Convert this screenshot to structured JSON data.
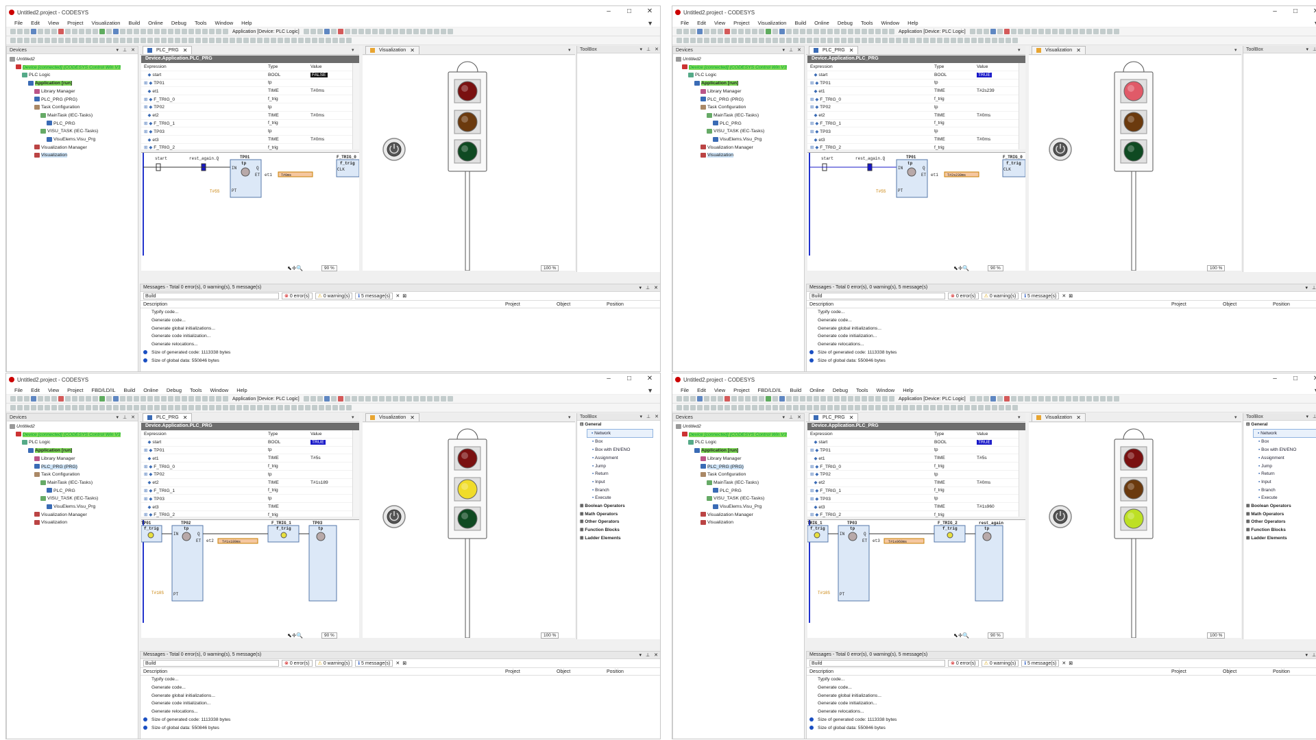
{
  "title": "Untitled2.project - CODESYS",
  "window_controls": [
    "–",
    "□",
    "✕"
  ],
  "menus_a": [
    "File",
    "Edit",
    "View",
    "Project",
    "Visualization",
    "Build",
    "Online",
    "Debug",
    "Tools",
    "Window",
    "Help"
  ],
  "menus_b": [
    "File",
    "Edit",
    "View",
    "Project",
    "FBD/LD/IL",
    "Build",
    "Online",
    "Debug",
    "Tools",
    "Window",
    "Help"
  ],
  "toolbar_app": "Application [Device: PLC Logic]",
  "devices_panel": "Devices",
  "toolbox_panel": "ToolBox",
  "tree": [
    "Untitled2",
    "Device [connected] (CODESYS Control Win V3",
    "PLC Logic",
    "Application [run]",
    "Library Manager",
    "PLC_PRG (PRG)",
    "Task Configuration",
    "MainTask (IEC-Tasks)",
    "PLC_PRG",
    "VISU_TASK (IEC-Tasks)",
    "VisuElems.Visu_Prg",
    "Visualization Manager",
    "Visualization"
  ],
  "tab_plc": "PLC_PRG",
  "tab_visu": "Visualization",
  "watch_title": "Device.Application.PLC_PRG",
  "watch_cols": [
    "Expression",
    "Type",
    "Value"
  ],
  "watch_rows": [
    {
      "e": "start",
      "t": "BOOL"
    },
    {
      "e": "TP01",
      "t": "tp"
    },
    {
      "e": "et1",
      "t": "TIME"
    },
    {
      "e": "F_TRIG_0",
      "t": "f_trig"
    },
    {
      "e": "TP02",
      "t": "tp"
    },
    {
      "e": "et2",
      "t": "TIME"
    },
    {
      "e": "F_TRIG_1",
      "t": "f_trig"
    },
    {
      "e": "TP03",
      "t": "tp"
    },
    {
      "e": "et3",
      "t": "TIME"
    },
    {
      "e": "F_TRIG_2",
      "t": "f_trig"
    }
  ],
  "quadrants": [
    {
      "menus": "a",
      "vals": {
        "start": "FALSE",
        "et1": "T#0ms",
        "et2": "T#0ms",
        "et3": "T#0ms"
      },
      "ld": "a",
      "et_box": "T#0ms",
      "lights": [
        "red-off",
        "yellow-off",
        "green-off"
      ],
      "toolbox_items": false
    },
    {
      "menus": "a",
      "vals": {
        "start": "TRUE",
        "et1": "T#2s239",
        "et2": "T#0ms",
        "et3": "T#0ms"
      },
      "ld": "a",
      "et_box": "T#2s239ms",
      "lights": [
        "red-on",
        "yellow-off",
        "green-off"
      ],
      "toolbox_items": false
    },
    {
      "menus": "b",
      "vals": {
        "start": "TRUE",
        "et1": "T#5s",
        "et2": "T#1s189",
        "et3": ""
      },
      "ld": "b",
      "et_box": "T#1s189ms",
      "lights": [
        "red-off",
        "yellow-on",
        "green-off"
      ],
      "toolbox_items": true
    },
    {
      "menus": "b",
      "vals": {
        "start": "TRUE",
        "et1": "T#5s",
        "et2": "T#0ms",
        "et3": "T#1s960"
      },
      "ld": "c",
      "et_box": "T#1s960ms",
      "lights": [
        "red-off",
        "yellow-off",
        "green-on"
      ],
      "toolbox_items": true
    }
  ],
  "ld_labels": {
    "start": "start",
    "rest": "rest_again.Q",
    "tp01": "TP01",
    "ftrig0": "F_TRIG_0",
    "tp": "tp",
    "ftrig": "f_trig",
    "in": "IN",
    "q": "Q",
    "pt": "PT",
    "et": "ET",
    "clk": "CLK",
    "et1": "et1",
    "et2": "et2",
    "et3": "et3",
    "t5": "T#5S",
    "t10": "T#10S",
    "tp02": "TP02",
    "ftrig1": "F_TRIG_1",
    "tp03": "TP03",
    "ftrig2": "F_TRIG_2",
    "rest2": "rest_again",
    "trig0": "TRIG_0",
    "trig1": "TRIG_1"
  },
  "zoom_ld": "90 %",
  "zoom_visu": "100 %",
  "toolbox": {
    "general": "General",
    "items": [
      "Network",
      "Box",
      "Box with EN/ENO",
      "Assignment",
      "Jump",
      "Return",
      "Input",
      "Branch",
      "Execute"
    ],
    "groups": [
      "Boolean Operators",
      "Math Operators",
      "Other Operators",
      "Function Blocks",
      "Ladder Elements"
    ]
  },
  "messages": {
    "title": "Messages - Total 0 error(s), 0 warning(s), 5 message(s)",
    "combo": "Build",
    "errors": "0 error(s)",
    "warnings": "0 warning(s)",
    "msgs": "5 message(s)",
    "cols": [
      "Description",
      "Project",
      "Object",
      "Position"
    ],
    "lines": [
      "Typify code...",
      "Generate code...",
      "Generate global initializations...",
      "Generate code initialization...",
      "Generate relocations..."
    ],
    "info": [
      "Size of generated code: 1113338 bytes",
      "Size of global data: 550846 bytes"
    ]
  },
  "colors": {
    "accent_green": "#7ed957",
    "true_blue": "#1717c8",
    "panel_head": "#6d6d6d"
  }
}
